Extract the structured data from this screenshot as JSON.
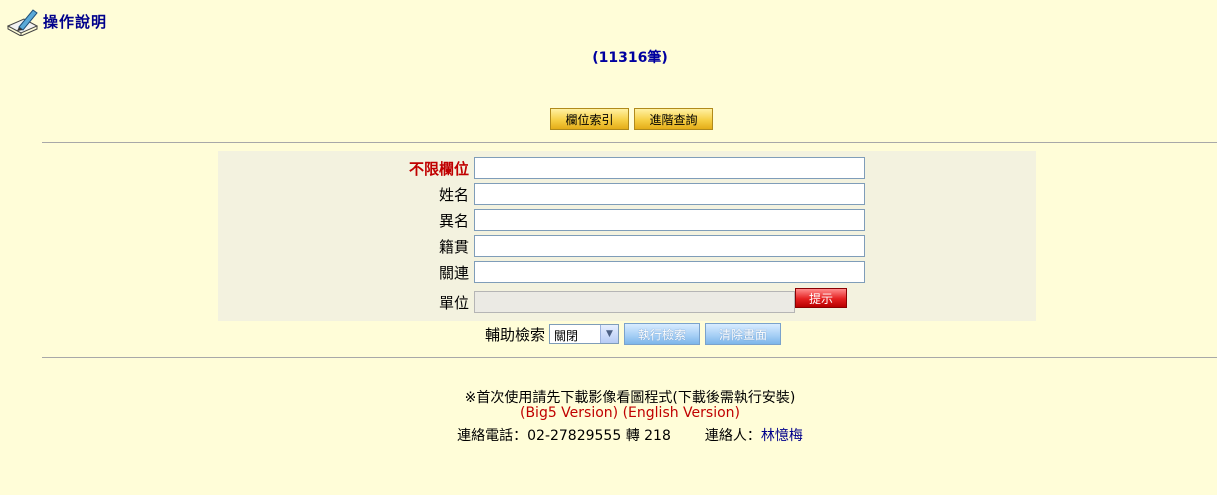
{
  "header": {
    "help_label": "操作說明",
    "help_icon": "pen-book-icon"
  },
  "result_count": "(11316筆)",
  "tabs": {
    "field_index": "欄位索引",
    "advanced_search": "進階查詢"
  },
  "form": {
    "fields": [
      {
        "label": "不限欄位",
        "value": ""
      },
      {
        "label": "姓名",
        "value": ""
      },
      {
        "label": "異名",
        "value": ""
      },
      {
        "label": "籍貫",
        "value": ""
      },
      {
        "label": "關連",
        "value": ""
      },
      {
        "label": "單位",
        "value": ""
      }
    ],
    "hint_button": "提示"
  },
  "assist": {
    "label": "輔助檢索",
    "selected": "關閉",
    "search_button": "執行檢索",
    "clear_button": "清除畫面"
  },
  "footer": {
    "notice": "※首次使用請先下載影像看圖程式(下載後需執行安裝)",
    "big5_link": "(Big5 Version)",
    "english_link": "(English Version)",
    "phone_label": "連絡電話：",
    "phone_value": "02-27829555 轉 218",
    "contact_label": "連絡人：",
    "contact_name": "林憶梅"
  },
  "colors": {
    "background": "#fffdd8",
    "form_bg": "#f3f2df",
    "accent_red": "#c00000",
    "accent_blue": "#00008b"
  }
}
